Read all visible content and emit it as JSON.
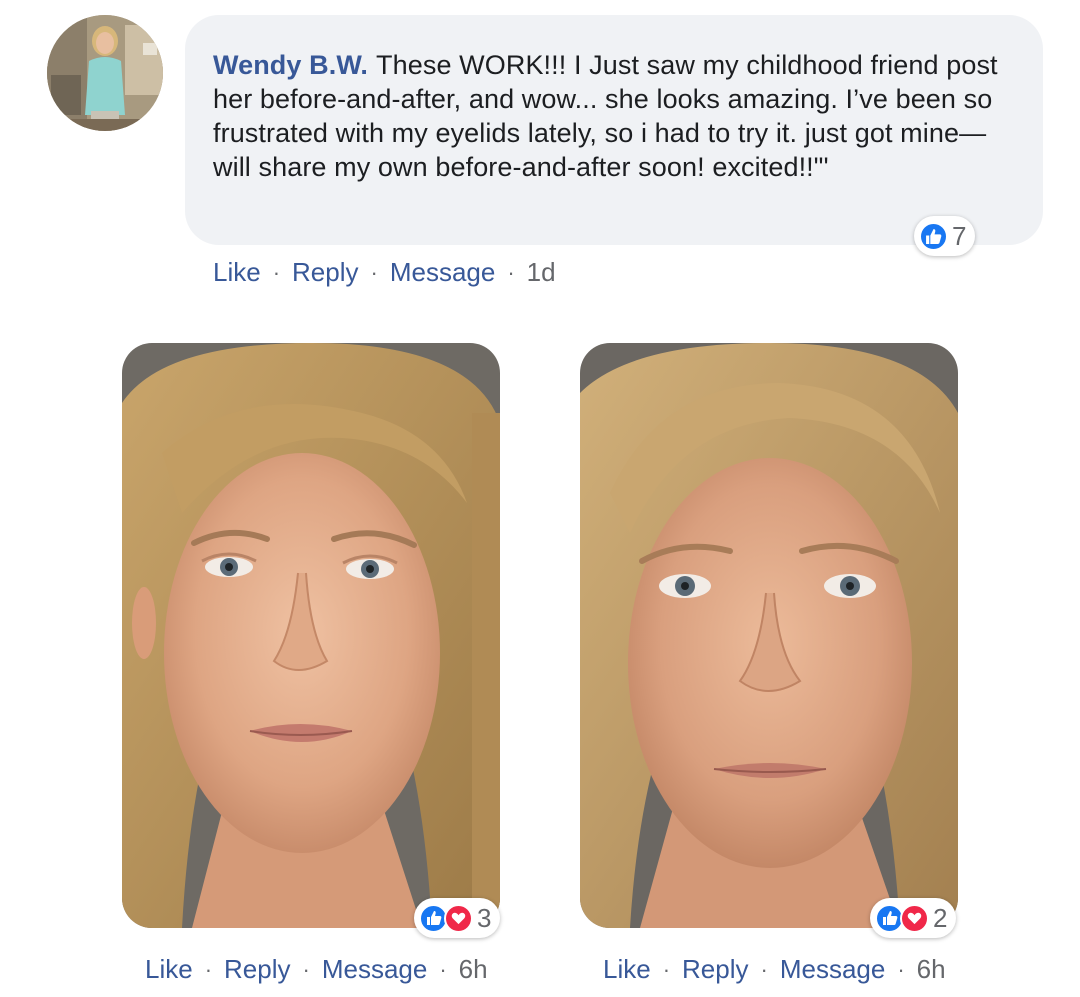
{
  "comment": {
    "author": "Wendy B.W.",
    "text": "These WORK!!! I Just saw my childhood friend post her before-and-after, and wow... she looks amazing. I’ve been so frustrated with my eyelids lately, so i had to try it. just got mine—will share my own before-and-after soon! excited!!\"'",
    "reaction_count": "7",
    "reaction_icons": [
      "like-icon"
    ],
    "actions": {
      "like": "Like",
      "reply": "Reply",
      "message": "Message",
      "separator": "·",
      "time": "1d"
    }
  },
  "photos": [
    {
      "reaction_count": "3",
      "reaction_icons": [
        "like-icon",
        "love-icon"
      ],
      "actions": {
        "like": "Like",
        "reply": "Reply",
        "message": "Message",
        "separator": "·",
        "time": "6h"
      }
    },
    {
      "reaction_count": "2",
      "reaction_icons": [
        "like-icon",
        "love-icon"
      ],
      "actions": {
        "like": "Like",
        "reply": "Reply",
        "message": "Message",
        "separator": "·",
        "time": "6h"
      }
    }
  ],
  "colors": {
    "link_blue": "#385898",
    "bubble_bg": "#f0f2f5",
    "meta_gray": "#65676b",
    "like_blue": "#1877f2",
    "love_red": "#f02849"
  }
}
